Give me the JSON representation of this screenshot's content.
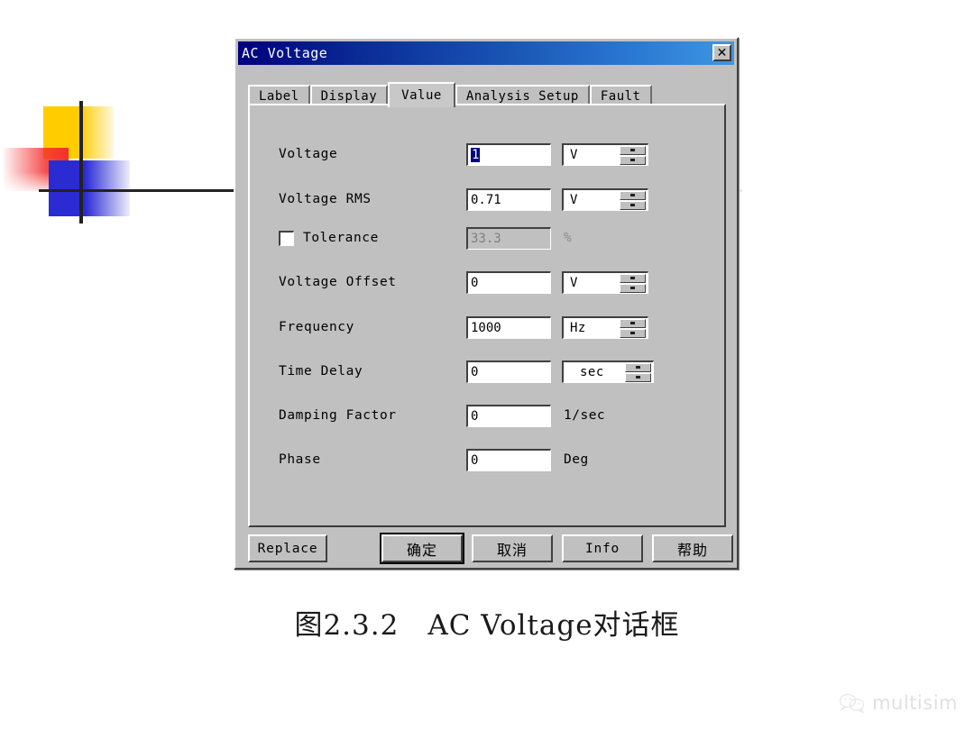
{
  "artwork": {
    "name": "decorative-color-blocks"
  },
  "dialog": {
    "title": "AC Voltage",
    "close_label": "✕",
    "tabs": [
      {
        "label": "Label",
        "active": false
      },
      {
        "label": "Display",
        "active": false
      },
      {
        "label": "Value",
        "active": true
      },
      {
        "label": "Analysis Setup",
        "active": false
      },
      {
        "label": "Fault",
        "active": false
      }
    ],
    "fields": [
      {
        "label": "Voltage",
        "value": "1",
        "selected": true,
        "unit": "V",
        "unit_type": "spinner",
        "enabled": true
      },
      {
        "label": "Voltage RMS",
        "value": "0.71",
        "selected": false,
        "unit": "V",
        "unit_type": "spinner",
        "enabled": true
      },
      {
        "label": "Tolerance",
        "value": "33.3",
        "selected": false,
        "unit": "%",
        "unit_type": "plain",
        "enabled": false,
        "checkbox": true,
        "checked": false
      },
      {
        "label": "Voltage Offset",
        "value": "0",
        "selected": false,
        "unit": "V",
        "unit_type": "spinner",
        "enabled": true
      },
      {
        "label": "Frequency",
        "value": "1000",
        "selected": false,
        "unit": "Hz",
        "unit_type": "spinner",
        "enabled": true
      },
      {
        "label": "Time Delay",
        "value": "0",
        "selected": false,
        "unit": "sec",
        "unit_type": "spinner",
        "enabled": true
      },
      {
        "label": "Damping Factor",
        "value": "0",
        "selected": false,
        "unit": "1/sec",
        "unit_type": "plain",
        "enabled": true
      },
      {
        "label": "Phase",
        "value": "0",
        "selected": false,
        "unit": "Deg",
        "unit_type": "plain",
        "enabled": true
      }
    ],
    "buttons": [
      {
        "label": "Replace",
        "default": false,
        "cjk": false
      },
      {
        "label": "确定",
        "default": true,
        "cjk": true
      },
      {
        "label": "取消",
        "default": false,
        "cjk": true
      },
      {
        "label": "Info",
        "default": false,
        "cjk": false
      },
      {
        "label": "帮助",
        "default": false,
        "cjk": true
      }
    ]
  },
  "caption": "图2.3.2　AC Voltage对话框",
  "watermark": {
    "text": "multisim",
    "icon": "wechat-icon"
  },
  "colors": {
    "titlebar_start": "#00007e",
    "titlebar_end": "#3f96e2",
    "dialog_face": "#c0c0c0",
    "selection": "#000080",
    "disabled_text": "#808080"
  }
}
